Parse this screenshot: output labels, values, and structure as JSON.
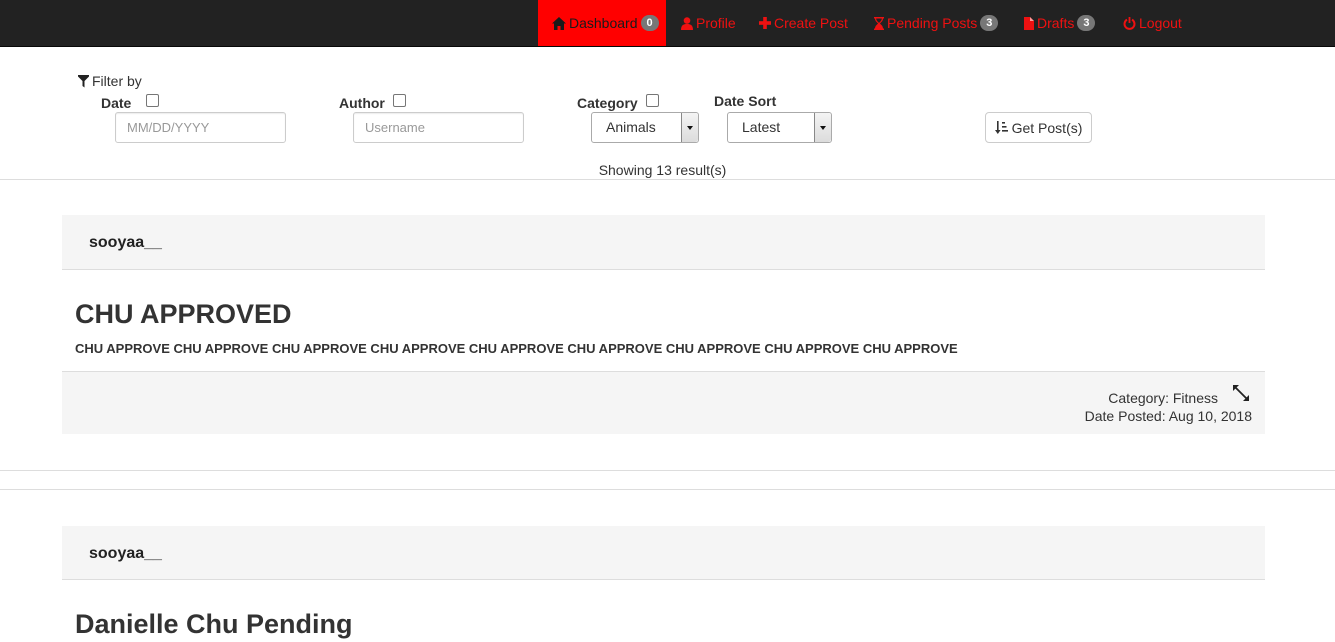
{
  "nav": {
    "dashboard": {
      "label": "Dashboard",
      "badge": "0"
    },
    "profile": {
      "label": "Profile"
    },
    "create_post": {
      "label": "Create Post"
    },
    "pending_posts": {
      "label": "Pending Posts",
      "badge": "3"
    },
    "drafts": {
      "label": "Drafts",
      "badge": "3"
    },
    "logout": {
      "label": "Logout"
    }
  },
  "filter": {
    "title": "Filter by",
    "date_label": "Date",
    "date_placeholder": "MM/DD/YYYY",
    "author_label": "Author",
    "author_placeholder": "Username",
    "category_label": "Category",
    "category_value": "Animals",
    "date_sort_label": "Date Sort",
    "date_sort_value": "Latest",
    "get_posts_label": "Get Post(s)"
  },
  "results": {
    "text": "Showing 13 result(s)"
  },
  "posts": [
    {
      "author": "sooyaa__",
      "title": "CHU APPROVED",
      "body": "CHU APPROVE CHU APPROVE CHU APPROVE CHU APPROVE CHU APPROVE CHU APPROVE CHU APPROVE CHU APPROVE CHU APPROVE",
      "category": "Category: Fitness",
      "date": "Date Posted: Aug 10, 2018"
    },
    {
      "author": "sooyaa__",
      "title": "Danielle Chu Pending"
    }
  ],
  "colors": {
    "navbar_bg": "#222222",
    "nav_text": "#ee1111",
    "active_bg": "#ff0000",
    "panel_bg": "#f5f5f5"
  }
}
